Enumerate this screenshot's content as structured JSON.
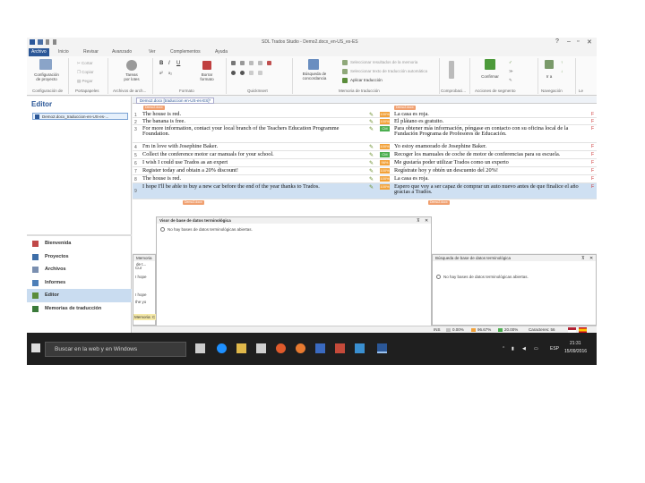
{
  "window": {
    "title": "SDL Trados Studio - Demo2.docx_en-US_es-ES"
  },
  "tabs": [
    "Archivo",
    "Inicio",
    "Revisar",
    "Avanzado",
    "Ver",
    "Complementos",
    "Ayuda"
  ],
  "ribbon": {
    "config_label_1": "Configuración",
    "config_label_2": "de proyecto",
    "cut": "Cortar",
    "copy": "Copiar",
    "paste": "Pegar",
    "tasks_label_1": "Tareas",
    "tasks_label_2": "por lotes",
    "format_clear_1": "Borrar",
    "format_clear_2": "formato",
    "concordance_1": "Búsqueda de",
    "concordance_2": "concordancia",
    "tm_opt1": "Seleccionar resultados de la memoria",
    "tm_opt2": "Seleccionar texto de traducción automática",
    "apply_translation": "Aplicar traducción",
    "confirm": "Confirmar",
    "goto": "Ir a",
    "groups": [
      "Configuración de",
      "Portapapeles",
      "Archivos de arch...",
      "Formato",
      "QuickInsert",
      "Memoria de traducción",
      "Comprobaci...",
      "Acciones de segmento",
      "Navegación",
      "Le"
    ]
  },
  "sidebar": {
    "header": "Editor",
    "file_item": "Demo2.docx_traduccion-en-US-es-...",
    "nav": [
      "Bienvenida",
      "Proyectos",
      "Archivos",
      "Informes",
      "Editor",
      "Memorias de traducción"
    ]
  },
  "editor": {
    "doc_tab": "Demo2.docx [traduccion en-US-es-ES]*",
    "doc_tag": "Demo2.docx",
    "rows": [
      {
        "num": "1",
        "source": "The house is red.",
        "pct": "100%",
        "target": "La casa es roja."
      },
      {
        "num": "2",
        "source": "The banana is free.",
        "pct": "100%",
        "target": "El plátano es gratuito."
      },
      {
        "num": "3",
        "source": "For more information, contact your local branch of the Teachers Education Programme Foundation.",
        "pct": "CM",
        "target": "Para obtener más información, póngase en contacto con su oficina local de la Fundación Programa de Profesores de Educación."
      },
      {
        "num": "4",
        "source": "I'm in love with Josephine Baker.",
        "pct": "100%",
        "target": "Yo estoy enamorado de Josephine Baker."
      },
      {
        "num": "5",
        "source": "Collect the conference motor car manuals for your school.",
        "pct": "CM",
        "target": "Recoger los manuales de coche de motor de conferencias para su escuela."
      },
      {
        "num": "6",
        "source": "I wish I could use Trados as an expert",
        "pct": "96%",
        "target": "Me gustaría poder utilizar Trados como un experto"
      },
      {
        "num": "7",
        "source": "Register today and obtain a 20% discount!",
        "pct": "100%",
        "target": "Regístrate hoy y obtén un descuento del 20%!"
      },
      {
        "num": "8",
        "source": "The house is red.",
        "pct": "100%",
        "target": "La casa es roja."
      },
      {
        "num": "9",
        "source": "I hope I'll be able to buy a new car before the end of the year thanks to Trados.",
        "pct": "100%",
        "target": "Espero que voy a ser capaz de comprar un auto nuevo antes de que finalice el año gracias a Trados."
      }
    ]
  },
  "termbase_viewer": {
    "title": "Visor de base de datos terminológica",
    "message": "No hay bases de datos terminológicas abiertas."
  },
  "termbase_search": {
    "title": "Búsqueda de base de datos terminológica",
    "message": "No hay bases de datos terminológicas abiertas."
  },
  "tm_results": {
    "title": "Memoria de t...",
    "rows": [
      "Cur",
      "I hope",
      "I hope",
      "the yo"
    ],
    "footer": "Memoria: C"
  },
  "statusbar": {
    "mode": "INS",
    "s1": "0.00%",
    "s2": "96.67%",
    "s3": "20.00%",
    "chars": "Caracteres: 56"
  },
  "taskbar": {
    "search_placeholder": "Buscar en la web y en Windows",
    "lang": "ESP",
    "time": "21:31",
    "date": "15/09/2016"
  }
}
